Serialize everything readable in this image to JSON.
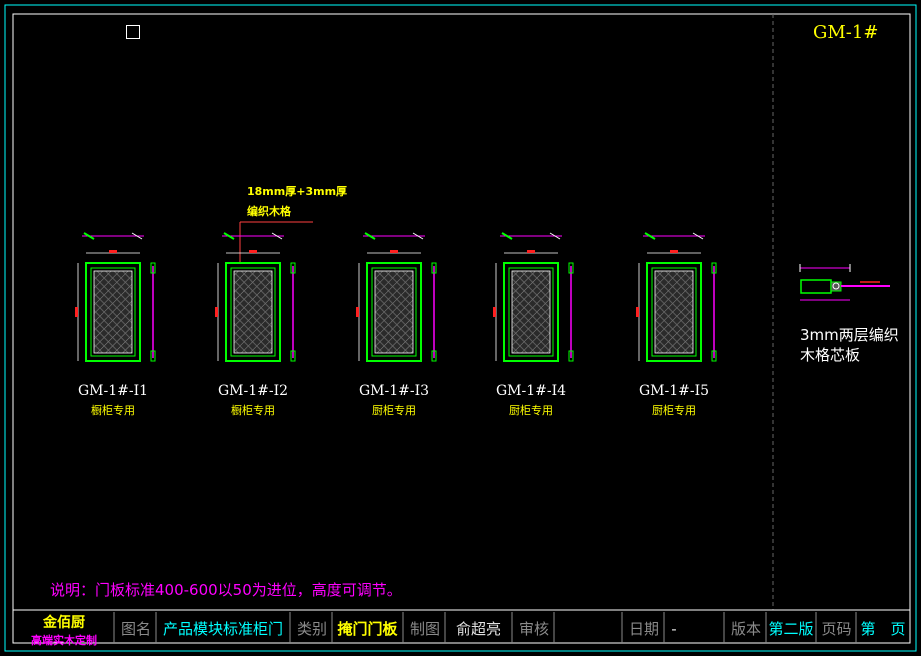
{
  "drawing_code": "GM-1#",
  "callout": {
    "line1": "18mm厚+3mm厚",
    "line2": "编织木格"
  },
  "doors": [
    {
      "code": "GM-1#-I1",
      "use": "橱柜专用"
    },
    {
      "code": "GM-1#-I2",
      "use": "橱柜专用"
    },
    {
      "code": "GM-1#-I3",
      "use": "厨柜专用"
    },
    {
      "code": "GM-1#-I4",
      "use": "厨柜专用"
    },
    {
      "code": "GM-1#-I5",
      "use": "厨柜专用"
    }
  ],
  "section": {
    "line1": "3mm两层编织",
    "line2": "木格芯板"
  },
  "note": "说明：门板标准400-600以50为进位，高度可调节。",
  "title_block": {
    "brand_line1": "金佰厨",
    "brand_line2": "高端实木定制",
    "drawing_name_label": "图名",
    "drawing_name": "产品模块标准柜门",
    "category_label": "类别",
    "category": "掩门门板",
    "drafter_label": "制图",
    "drafter": "俞超亮",
    "review_label": "审核",
    "date_label": "日期",
    "date": "-",
    "version_label": "版本",
    "version": "第二版",
    "page_label": "页码",
    "page": "第　页"
  },
  "colors": {
    "frame": "#00ffff",
    "door_outer": "#00ff00",
    "dimension": "#ff00ff",
    "panel_fill": "#262626",
    "text_yellow": "#ffff00"
  }
}
